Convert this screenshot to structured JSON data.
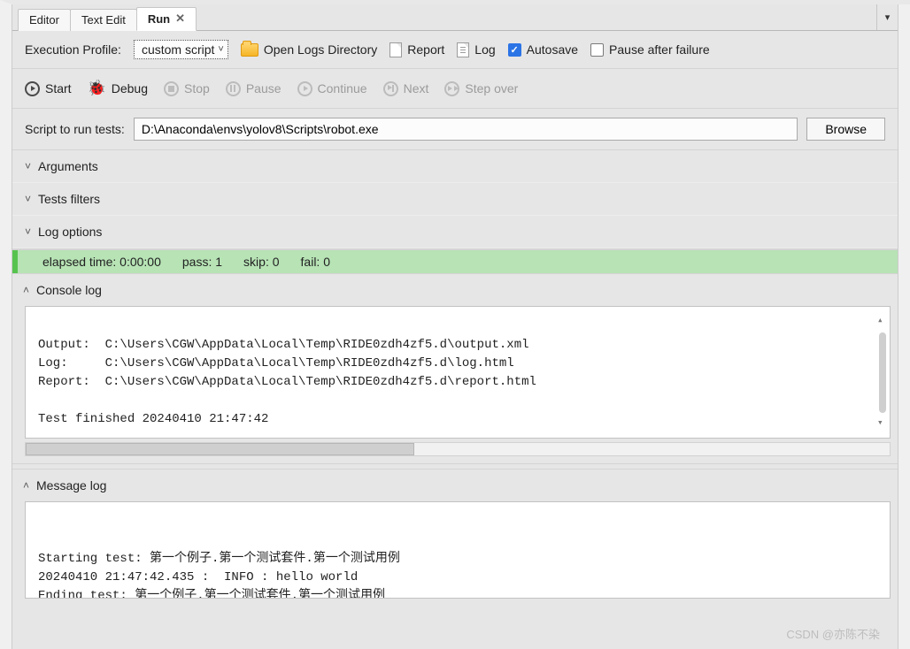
{
  "tabs": {
    "editor": "Editor",
    "text_edit": "Text Edit",
    "run": "Run"
  },
  "exec_profile": {
    "label": "Execution Profile:",
    "value": "custom script"
  },
  "open_logs": "Open Logs Directory",
  "report_link": "Report",
  "log_link": "Log",
  "autosave": {
    "label": "Autosave",
    "checked": true
  },
  "pause_after_failure": {
    "label": "Pause after failure",
    "checked": false
  },
  "run_controls": {
    "start": "Start",
    "debug": "Debug",
    "stop": "Stop",
    "pause": "Pause",
    "continue": "Continue",
    "next": "Next",
    "step_over": "Step over"
  },
  "script": {
    "label": "Script to run tests:",
    "value": "D:\\Anaconda\\envs\\yolov8\\Scripts\\robot.exe",
    "browse": "Browse"
  },
  "expandables": {
    "arguments": "Arguments",
    "tests_filters": "Tests filters",
    "log_options": "Log options"
  },
  "status": {
    "elapsed_label": "elapsed time:",
    "elapsed_value": "0:00:00",
    "pass_label": "pass:",
    "pass_value": "1",
    "skip_label": "skip:",
    "skip_value": "0",
    "fail_label": "fail:",
    "fail_value": "0"
  },
  "console": {
    "header": "Console log",
    "body": "Output:  C:\\Users\\CGW\\AppData\\Local\\Temp\\RIDE0zdh4zf5.d\\output.xml\nLog:     C:\\Users\\CGW\\AppData\\Local\\Temp\\RIDE0zdh4zf5.d\\log.html\nReport:  C:\\Users\\CGW\\AppData\\Local\\Temp\\RIDE0zdh4zf5.d\\report.html\n\nTest finished 20240410 21:47:42"
  },
  "message": {
    "header": "Message log",
    "body": "\nStarting test: 第一个例子.第一个测试套件.第一个测试用例\n20240410 21:47:42.435 :  INFO : hello world\nEnding test: 第一个例子.第一个测试套件.第一个测试用例"
  },
  "watermark": "CSDN @亦陈不染"
}
